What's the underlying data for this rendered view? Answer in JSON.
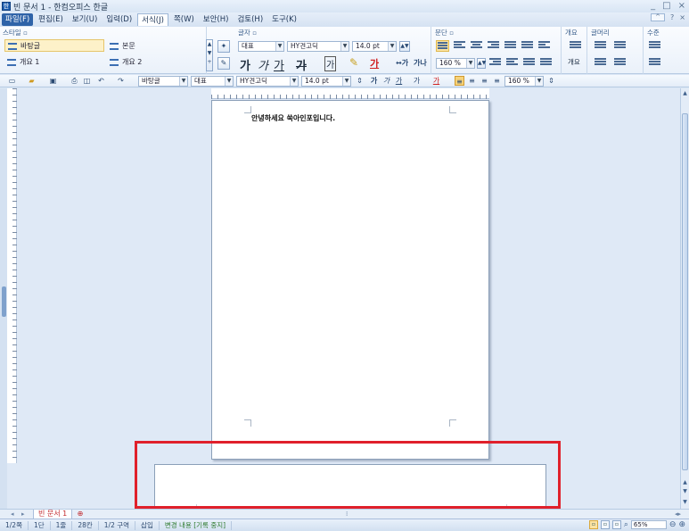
{
  "window": {
    "title": "빈 문서 1 - 한컴오피스 한글",
    "controls": [
      "_",
      "□",
      "×"
    ]
  },
  "menu": {
    "items": [
      "파일(F)",
      "편집(E)",
      "보기(U)",
      "입력(D)",
      "서식(J)",
      "쪽(W)",
      "보안(H)",
      "검토(H)",
      "도구(K)"
    ],
    "active": "서식(J)",
    "right_help": "?"
  },
  "ribbon": {
    "style_group": {
      "title": "스타일",
      "items": [
        "바탕글",
        "본문",
        "개요 1",
        "개요 2"
      ],
      "selected": "바탕글"
    },
    "char_group": {
      "title": "글자",
      "lang_combo": "대표",
      "font_combo": "HY견고딕",
      "size_combo": "14.0",
      "size_unit": "pt",
      "bold_label": "가",
      "italic_label": "가",
      "underline_label": "가",
      "strike_label": "가",
      "shade_label": "가",
      "color_label": "가"
    },
    "para_group": {
      "title": "문단",
      "line_spacing": "160",
      "line_unit": "%"
    },
    "outline_group": {
      "title": "개요",
      "label": "개요"
    },
    "bullet_group": {
      "title": "글머리"
    },
    "level_group": {
      "title": "수준"
    }
  },
  "toolbar": {
    "style_combo": "바탕글",
    "lang_combo": "대표",
    "font_combo": "HY견고딕",
    "size_combo": "14.0",
    "size_unit": "pt",
    "line_spacing": "160",
    "line_unit": "%"
  },
  "document": {
    "text": "안녕하세요 쑥아인포입니다."
  },
  "tabs": {
    "doc_tab": "빈 문서 1"
  },
  "status": {
    "page": "1/2쪽",
    "column": "1단",
    "line": "1줄",
    "char": "28칸",
    "section": "1/2 구역",
    "mode": "삽입",
    "track": "변경 내용 [기록 중지]",
    "zoom": "65%"
  },
  "colors": {
    "accent": "#2f63a8",
    "highlight_border": "#e0202b",
    "track_text": "#2d7a2d"
  }
}
